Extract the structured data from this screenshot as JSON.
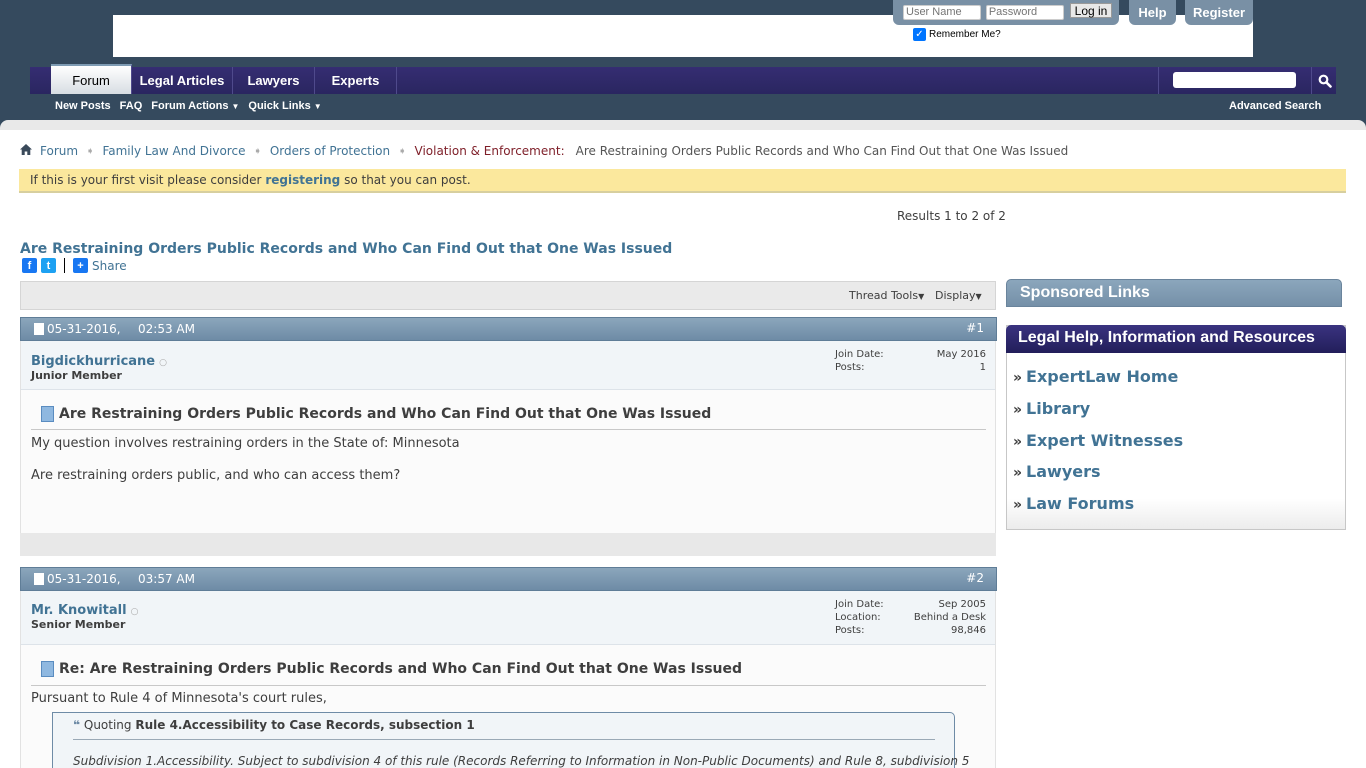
{
  "header": {
    "login": {
      "username_placeholder": "User Name",
      "password_placeholder": "Password",
      "login_label": "Log in",
      "remember_label": "Remember Me?",
      "remember_checked": true
    },
    "help_label": "Help",
    "register_label": "Register",
    "nav_tabs": [
      {
        "label": "Forum",
        "active": true
      },
      {
        "label": "Legal Articles",
        "active": false
      },
      {
        "label": "Lawyers",
        "active": false
      },
      {
        "label": "Experts",
        "active": false
      }
    ],
    "subnav": [
      {
        "label": "New Posts"
      },
      {
        "label": "FAQ"
      },
      {
        "label": "Forum Actions",
        "dropdown": true
      },
      {
        "label": "Quick Links",
        "dropdown": true
      }
    ],
    "search_placeholder": "",
    "advanced_search_label": "Advanced Search"
  },
  "breadcrumb": {
    "items": [
      "Forum",
      "Family Law And Divorce",
      "Orders of Protection"
    ],
    "current_forum": "Violation & Enforcement:",
    "current_thread": "Are Restraining Orders Public Records and Who Can Find Out that One Was Issued"
  },
  "notice": {
    "before": "If this is your first visit please consider ",
    "link": "registering",
    "after": " so that you can post."
  },
  "results_text": "Results 1 to 2 of 2",
  "thread": {
    "title": "Are Restraining Orders Public Records and Who Can Find Out that One Was Issued",
    "share_label": "Share",
    "tools": {
      "thread_tools": "Thread Tools",
      "display": "Display"
    }
  },
  "posts": [
    {
      "date": "05-31-2016,",
      "time": "02:53 AM",
      "number": "#1",
      "username": "Bigdickhurricane",
      "rank": "Junior Member",
      "stats": [
        {
          "label": "Join Date:",
          "value": "May 2016"
        },
        {
          "label": "Posts:",
          "value": "1"
        }
      ],
      "title": "Are Restraining Orders Public Records and Who Can Find Out that One Was Issued",
      "paragraphs": [
        "My question involves restraining orders in the State of: Minnesota",
        "Are restraining orders public, and who can access them?"
      ]
    },
    {
      "date": "05-31-2016,",
      "time": "03:57 AM",
      "number": "#2",
      "username": "Mr. Knowitall",
      "rank": "Senior Member",
      "stats": [
        {
          "label": "Join Date:",
          "value": "Sep 2005"
        },
        {
          "label": "Location:",
          "value": "Behind a Desk"
        },
        {
          "label": "Posts:",
          "value": "98,846"
        }
      ],
      "title": "Re: Are Restraining Orders Public Records and Who Can Find Out that One Was Issued",
      "paragraphs": [
        "Pursuant to Rule 4 of Minnesota's court rules,"
      ],
      "quote": {
        "prefix": "Quoting",
        "source": "Rule 4.Accessibility to Case Records, subsection 1",
        "text": "Subdivision 1.Accessibility. Subject to subdivision 4 of this rule (Records Referring to Information in Non-Public Documents) and Rule 8, subdivision 5"
      }
    }
  ],
  "sidebar": {
    "sponsored_title": "Sponsored Links",
    "resources_title": "Legal Help, Information and Resources",
    "links": [
      "ExpertLaw Home",
      "Library",
      "Expert Witnesses",
      "Lawyers",
      "Law Forums"
    ]
  },
  "colors": {
    "header_bg": "#354a5e",
    "nav_bg": "#2a2660",
    "link": "#417394",
    "post_head": "#7b97b0",
    "notice_bg": "#fbe89d"
  }
}
